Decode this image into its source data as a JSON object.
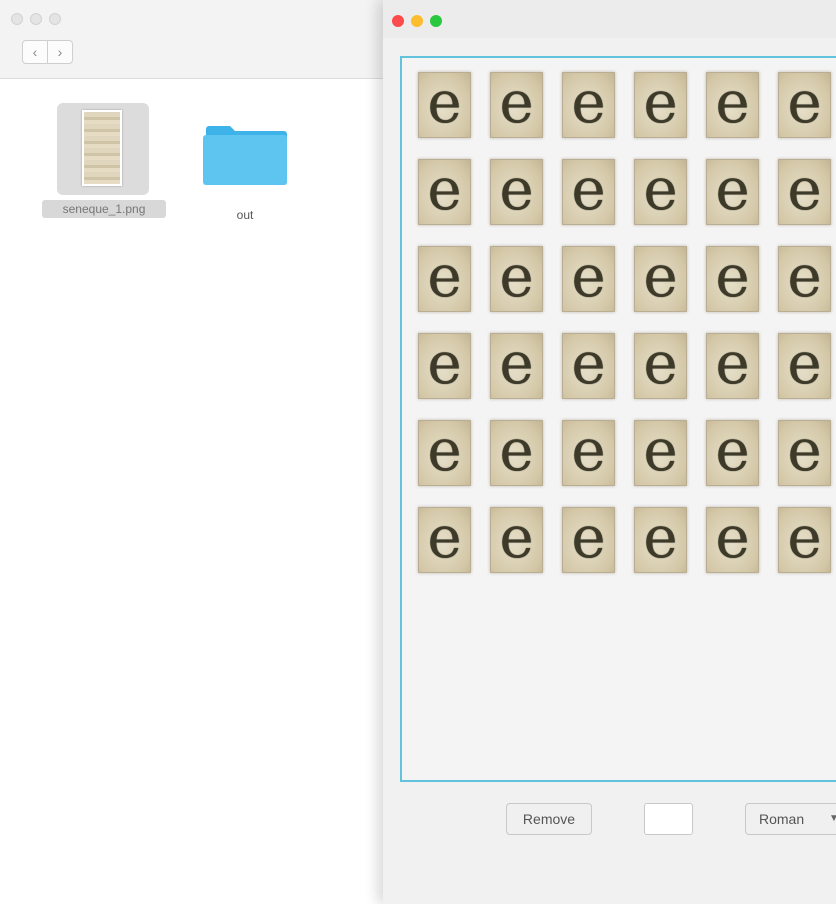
{
  "finder": {
    "nav": {
      "back_icon": "‹",
      "forward_icon": "›"
    },
    "files": [
      {
        "name": "seneque_1.png",
        "icon": "image-thumbnail-icon",
        "selected": true
      },
      {
        "name": "out",
        "icon": "folder-icon",
        "selected": false
      }
    ]
  },
  "app": {
    "glyph_char": "e",
    "glyph_grid": {
      "rows": 6,
      "columns_visible": 6
    },
    "remove_label": "Remove",
    "label_input_value": "",
    "font_select_value": "Roman",
    "accent_color": "#64c3dc",
    "traffic_lights": [
      "#fc4b4c",
      "#fdbd2f",
      "#2ac83f"
    ],
    "folder_color": "#3db3e9"
  }
}
